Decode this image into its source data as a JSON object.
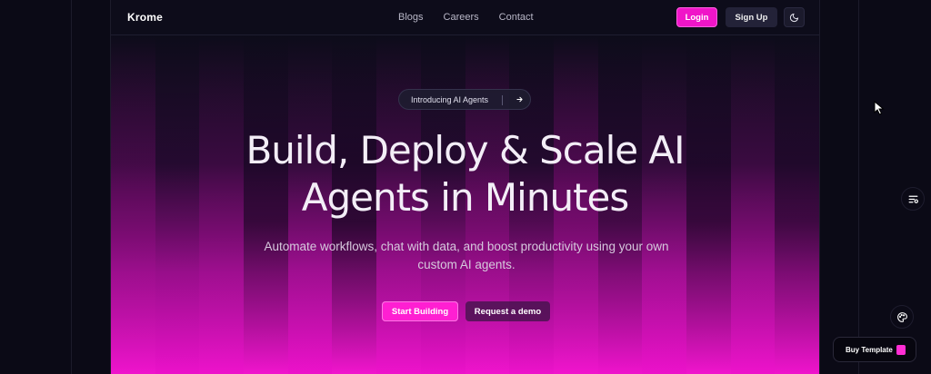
{
  "nav": {
    "brand": "Krome",
    "links": [
      "Blogs",
      "Careers",
      "Contact"
    ],
    "login": "Login",
    "signup": "Sign Up",
    "theme_icon": "moon-icon"
  },
  "hero": {
    "badge": "Introducing AI Agents",
    "badge_icon": "arrow-right-icon",
    "title_line1": "Build, Deploy & Scale AI",
    "title_line2": "Agents in Minutes",
    "subtitle": "Automate workflows, chat with data, and boost productivity using your own custom AI agents.",
    "cta_primary": "Start Building",
    "cta_secondary": "Request a demo"
  },
  "floating": {
    "buy_label": "Buy Template",
    "list_icon": "list-settings-icon",
    "palette_icon": "palette-icon",
    "bag_icon": "shopping-bag-icon"
  },
  "colors": {
    "accent": "#f015c8",
    "background": "#0d0c1a"
  }
}
